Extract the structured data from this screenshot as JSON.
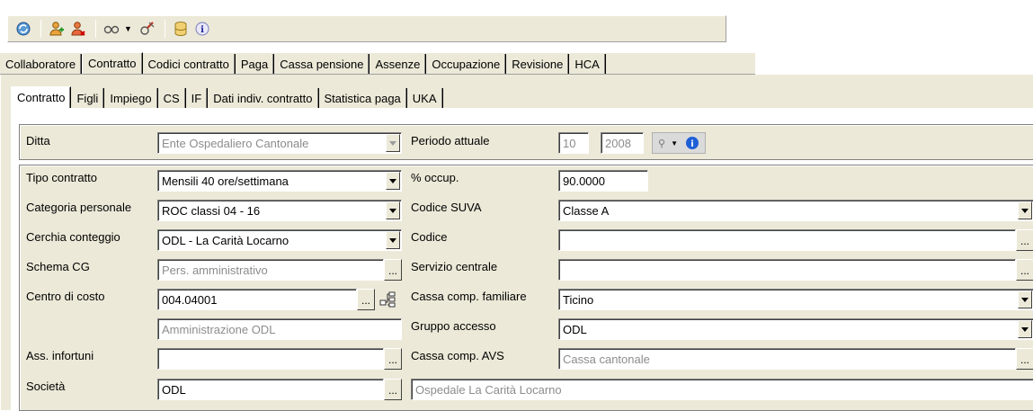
{
  "toolbar": {
    "icons": [
      "refresh-icon",
      "add-person-icon",
      "remove-person-icon",
      "view-icon",
      "dropdown-arrow-icon",
      "tools-icon",
      "database-icon",
      "info-icon"
    ]
  },
  "main_tabs": [
    {
      "label": "Collaboratore",
      "active": false
    },
    {
      "label": "Contratto",
      "active": true
    },
    {
      "label": "Codici contratto",
      "active": false
    },
    {
      "label": "Paga",
      "active": false
    },
    {
      "label": "Cassa pensione",
      "active": false
    },
    {
      "label": "Assenze",
      "active": false
    },
    {
      "label": "Occupazione",
      "active": false
    },
    {
      "label": "Revisione",
      "active": false
    },
    {
      "label": "HCA",
      "active": false
    }
  ],
  "sub_tabs": [
    {
      "label": "Contratto",
      "active": true
    },
    {
      "label": "Figli",
      "active": false
    },
    {
      "label": "Impiego",
      "active": false
    },
    {
      "label": "CS",
      "active": false
    },
    {
      "label": "IF",
      "active": false
    },
    {
      "label": "Dati indiv. contratto",
      "active": false
    },
    {
      "label": "Statistica paga",
      "active": false
    },
    {
      "label": "UKA",
      "active": false
    }
  ],
  "header_group": {
    "ditta_label": "Ditta",
    "ditta_value": "Ente Ospedaliero Cantonale",
    "periodo_label": "Periodo attuale",
    "periodo_month": "10",
    "periodo_year": "2008"
  },
  "form": {
    "tipo_contratto_label": "Tipo contratto",
    "tipo_contratto_value": "Mensili 40 ore/settimana",
    "occup_label": "% occup.",
    "occup_value": "90.0000",
    "categoria_label": "Categoria personale",
    "categoria_value": "ROC classi 04 - 16",
    "suva_label": "Codice SUVA",
    "suva_value": "Classe A",
    "cerchia_label": "Cerchia conteggio",
    "cerchia_value": "ODL - La Carità Locarno",
    "codice_label": "Codice",
    "codice_value": "",
    "schema_label": "Schema CG",
    "schema_value": "Pers. amministrativo",
    "servizio_label": "Servizio centrale",
    "servizio_value": "",
    "centro_label": "Centro di costo",
    "centro_value": "004.04001",
    "cassa_fam_label": "Cassa comp. familiare",
    "cassa_fam_value": "Ticino",
    "centro_desc": "Amministrazione ODL",
    "gruppo_label": "Gruppo accesso",
    "gruppo_value": "ODL",
    "ass_label": "Ass. infortuni",
    "ass_value": "",
    "avs_label": "Cassa comp. AVS",
    "avs_value": "Cassa cantonale",
    "societa_label": "Società",
    "societa_value": "ODL",
    "societa_desc": "Ospedale La Carità Locarno"
  },
  "ellipsis": "..."
}
